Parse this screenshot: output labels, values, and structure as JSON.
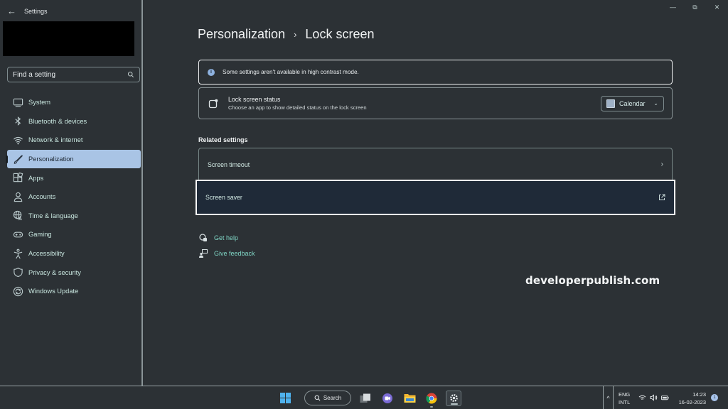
{
  "window": {
    "app_title": "Settings",
    "controls": {
      "minimize": "—",
      "restore": "⧉",
      "close": "✕"
    }
  },
  "sidebar": {
    "search": {
      "placeholder": "Find a setting",
      "value": ""
    },
    "items": [
      {
        "label": "System",
        "icon": "monitor-icon",
        "active": false
      },
      {
        "label": "Bluetooth & devices",
        "icon": "bluetooth-icon",
        "active": false
      },
      {
        "label": "Network & internet",
        "icon": "wifi-icon",
        "active": false
      },
      {
        "label": "Personalization",
        "icon": "brush-icon",
        "active": true
      },
      {
        "label": "Apps",
        "icon": "apps-icon",
        "active": false
      },
      {
        "label": "Accounts",
        "icon": "person-icon",
        "active": false
      },
      {
        "label": "Time & language",
        "icon": "globe-clock-icon",
        "active": false
      },
      {
        "label": "Gaming",
        "icon": "gamepad-icon",
        "active": false
      },
      {
        "label": "Accessibility",
        "icon": "accessibility-icon",
        "active": false
      },
      {
        "label": "Privacy & security",
        "icon": "shield-icon",
        "active": false
      },
      {
        "label": "Windows Update",
        "icon": "update-icon",
        "active": false
      }
    ]
  },
  "main": {
    "breadcrumb": {
      "parent": "Personalization",
      "separator": "›",
      "current": "Lock screen"
    },
    "info_bar": {
      "icon": "info-icon",
      "text": "Some settings aren't available in high contrast mode."
    },
    "lock_screen_status": {
      "title": "Lock screen status",
      "description": "Choose an app to show detailed status on the lock screen",
      "selected": "Calendar"
    },
    "related_settings": {
      "heading": "Related settings",
      "items": [
        {
          "label": "Screen timeout",
          "icon": "chevron-right-icon"
        },
        {
          "label": "Screen saver",
          "icon": "external-link-icon"
        }
      ]
    },
    "help_links": [
      {
        "label": "Get help",
        "icon": "help-icon"
      },
      {
        "label": "Give feedback",
        "icon": "feedback-icon"
      }
    ]
  },
  "watermark": "developerpublish.com",
  "taskbar": {
    "search_label": "Search",
    "language": {
      "line1": "ENG",
      "line2": "INTL"
    },
    "clock": {
      "time": "14:23",
      "date": "16-02-2023"
    },
    "notification_count": "1"
  },
  "colors": {
    "background": "#2c3135",
    "accent_active": "#a9c4e5",
    "link": "#7fd4c4",
    "focus_outline": "#ffffff"
  }
}
